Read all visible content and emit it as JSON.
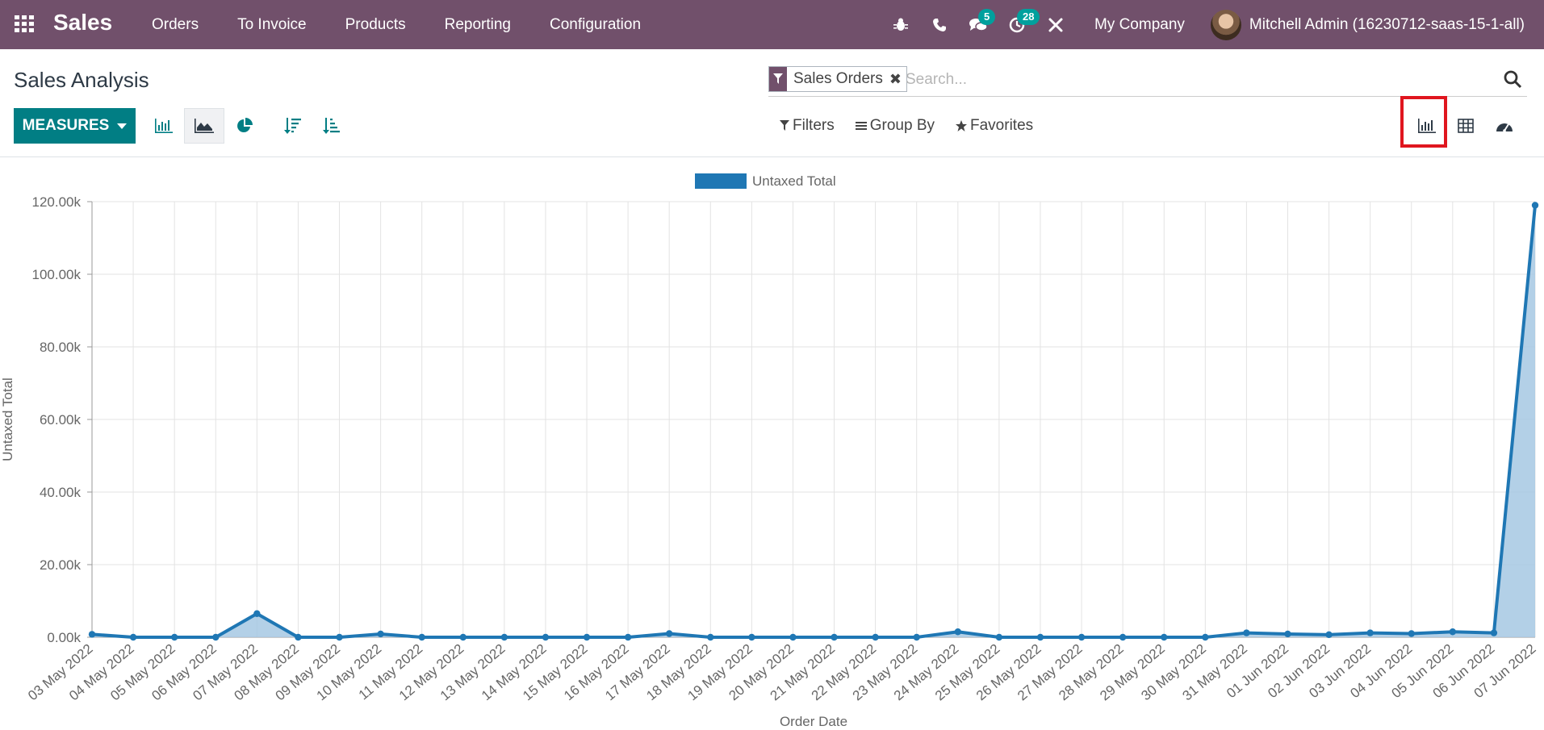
{
  "navbar": {
    "brand": "Sales",
    "menu": [
      "Orders",
      "To Invoice",
      "Products",
      "Reporting",
      "Configuration"
    ],
    "messages_count": "5",
    "activities_count": "28",
    "company": "My Company",
    "user": "Mitchell Admin (16230712-saas-15-1-all)",
    "bg_color": "#71506b"
  },
  "control_panel": {
    "title": "Sales Analysis",
    "facet_label": "Sales Orders",
    "search_placeholder": "Search...",
    "measures_label": "MEASURES",
    "filters_label": "Filters",
    "group_by_label": "Group By",
    "favorites_label": "Favorites",
    "accent_color": "#017e84"
  },
  "chart_data": {
    "type": "area",
    "legend": [
      "Untaxed Total"
    ],
    "legend_position": "top-center",
    "xlabel": "Order Date",
    "ylabel": "Untaxed Total",
    "ylim": [
      0,
      120000
    ],
    "yticks": [
      "0.00k",
      "20.00k",
      "40.00k",
      "60.00k",
      "80.00k",
      "100.00k",
      "120.00k"
    ],
    "grid": true,
    "series_color": "#1f77b4",
    "fill_color": "#a6c8e3",
    "x": [
      "03 May 2022",
      "04 May 2022",
      "05 May 2022",
      "06 May 2022",
      "07 May 2022",
      "08 May 2022",
      "09 May 2022",
      "10 May 2022",
      "11 May 2022",
      "12 May 2022",
      "13 May 2022",
      "14 May 2022",
      "15 May 2022",
      "16 May 2022",
      "17 May 2022",
      "18 May 2022",
      "19 May 2022",
      "20 May 2022",
      "21 May 2022",
      "22 May 2022",
      "23 May 2022",
      "24 May 2022",
      "25 May 2022",
      "26 May 2022",
      "27 May 2022",
      "28 May 2022",
      "29 May 2022",
      "30 May 2022",
      "31 May 2022",
      "01 Jun 2022",
      "02 Jun 2022",
      "03 Jun 2022",
      "04 Jun 2022",
      "05 Jun 2022",
      "06 Jun 2022",
      "07 Jun 2022"
    ],
    "series": [
      {
        "name": "Untaxed Total",
        "values": [
          800,
          0,
          0,
          0,
          6500,
          0,
          0,
          900,
          0,
          0,
          0,
          0,
          0,
          0,
          1000,
          0,
          0,
          0,
          0,
          0,
          0,
          1500,
          0,
          0,
          0,
          0,
          0,
          0,
          1200,
          900,
          700,
          1200,
          1000,
          1500,
          1200,
          119000
        ]
      }
    ]
  }
}
